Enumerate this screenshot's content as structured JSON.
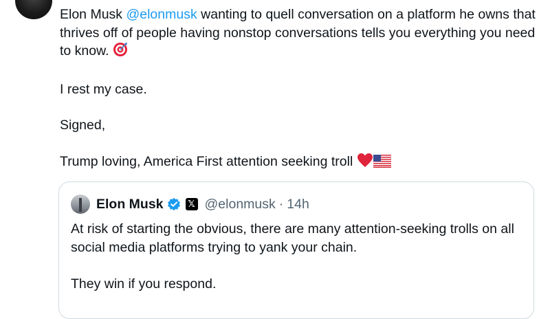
{
  "reply": {
    "author_mention": "@elonmusk",
    "line_before_mention": "Elon Musk ",
    "line_after_mention": " wanting to quell conversation on a platform he owns that thrives off of people having nonstop conversations tells you everything you need to know.",
    "paragraph2": "I rest my case.",
    "paragraph3": "Signed,",
    "paragraph4": "Trump loving, America First attention seeking troll",
    "emoji_after_p1": "direct-hit-target-icon",
    "emojis_after_p4": [
      "red-heart-icon",
      "us-flag-icon"
    ]
  },
  "quote": {
    "name": "Elon Musk",
    "handle": "@elonmusk",
    "separator": "·",
    "time": "14h",
    "verified_color": "#1d9bf0",
    "paragraph1": "At risk of starting the obvious, there are many attention-seeking trolls on all social media platforms trying to yank your chain.",
    "paragraph2": "They win if you respond."
  },
  "colors": {
    "link": "#1d9bf0",
    "text": "#0f1419",
    "secondary": "#536471",
    "border": "#cfd9de"
  }
}
